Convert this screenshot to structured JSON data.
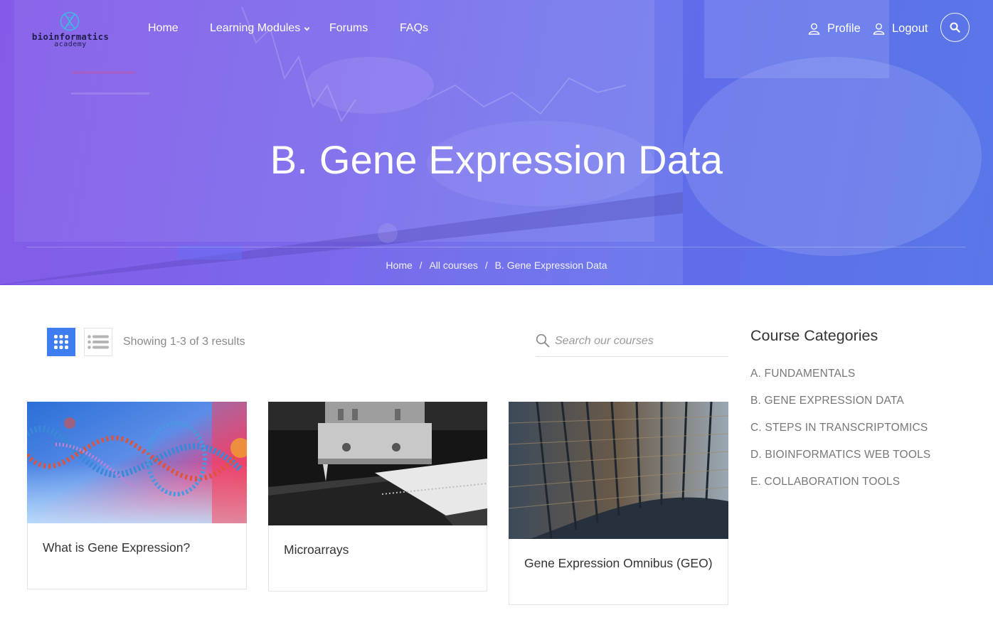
{
  "colors": {
    "accent": "#3d7df0",
    "hero_purple": "#7a4ee6",
    "hero_blue": "#5877e6"
  },
  "header": {
    "logo": {
      "name": "bioinformatics",
      "sub": "academy",
      "icon": "dna-x-logo"
    },
    "nav": [
      {
        "label": "Home"
      },
      {
        "label": "Learning Modules",
        "icon": "chevron-down-icon"
      },
      {
        "label": "Forums"
      },
      {
        "label": "FAQs"
      }
    ],
    "account": {
      "profile": "Profile",
      "logout": "Logout",
      "icon": "user-icon"
    },
    "search_icon": "search-icon"
  },
  "hero": {
    "title": "B. Gene Expression Data",
    "breadcrumb": {
      "home": "Home",
      "all_courses": "All courses",
      "current": "B. Gene Expression Data",
      "separator": "/"
    }
  },
  "toolbar": {
    "grid_view_icon": "grid-icon",
    "list_view_icon": "list-icon",
    "results_text": "Showing 1-3 of 3 results",
    "search_placeholder": "Search our courses"
  },
  "courses": [
    {
      "title": "What is Gene Expression?",
      "image": "dna-helix-image"
    },
    {
      "title": "Microarrays",
      "image": "microarray-machine-image"
    },
    {
      "title": "Gene Expression Omnibus (GEO)",
      "image": "library-shelves-image"
    }
  ],
  "sidebar": {
    "title": "Course Categories",
    "categories": [
      "A. FUNDAMENTALS",
      "B. GENE EXPRESSION DATA",
      "C. STEPS IN TRANSCRIPTOMICS",
      "D. BIOINFORMATICS WEB TOOLS",
      "E. COLLABORATION TOOLS"
    ]
  }
}
